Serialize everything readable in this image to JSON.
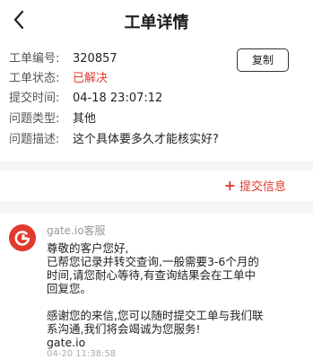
{
  "header": {
    "title": "工单详情",
    "back_icon": "chevron-left-icon"
  },
  "ticket": {
    "number_label": "工单编号:",
    "number_value": "320857",
    "status_label": "工单状态:",
    "status_value": "已解决",
    "time_label": "提交时间:",
    "time_value": "04-18 23:07:12",
    "type_label": "问题类型:",
    "type_value": "其他",
    "desc_label": "问题描述:",
    "desc_value": "这个具体要多久才能核实好?",
    "copy_label": "复制"
  },
  "actions": {
    "add_info_label": "提交信息",
    "add_info_icon": "plus-icon"
  },
  "message": {
    "sender": "gate.io客服",
    "lines": [
      "尊敬的客户您好,",
      "已帮您记录并转交查询,一般需要3-6个月的",
      "时间,请您耐心等待,有查询结果会在工单中",
      "回复您。",
      "",
      "感谢您的来信,您可以随时提交工单与我们联",
      "系沟通,我们将会竭诚为您服务!",
      "gate.io"
    ],
    "time": "04-20 11:38:58"
  },
  "colors": {
    "accent": "#e23a2e",
    "background": "#f5f5f5"
  }
}
